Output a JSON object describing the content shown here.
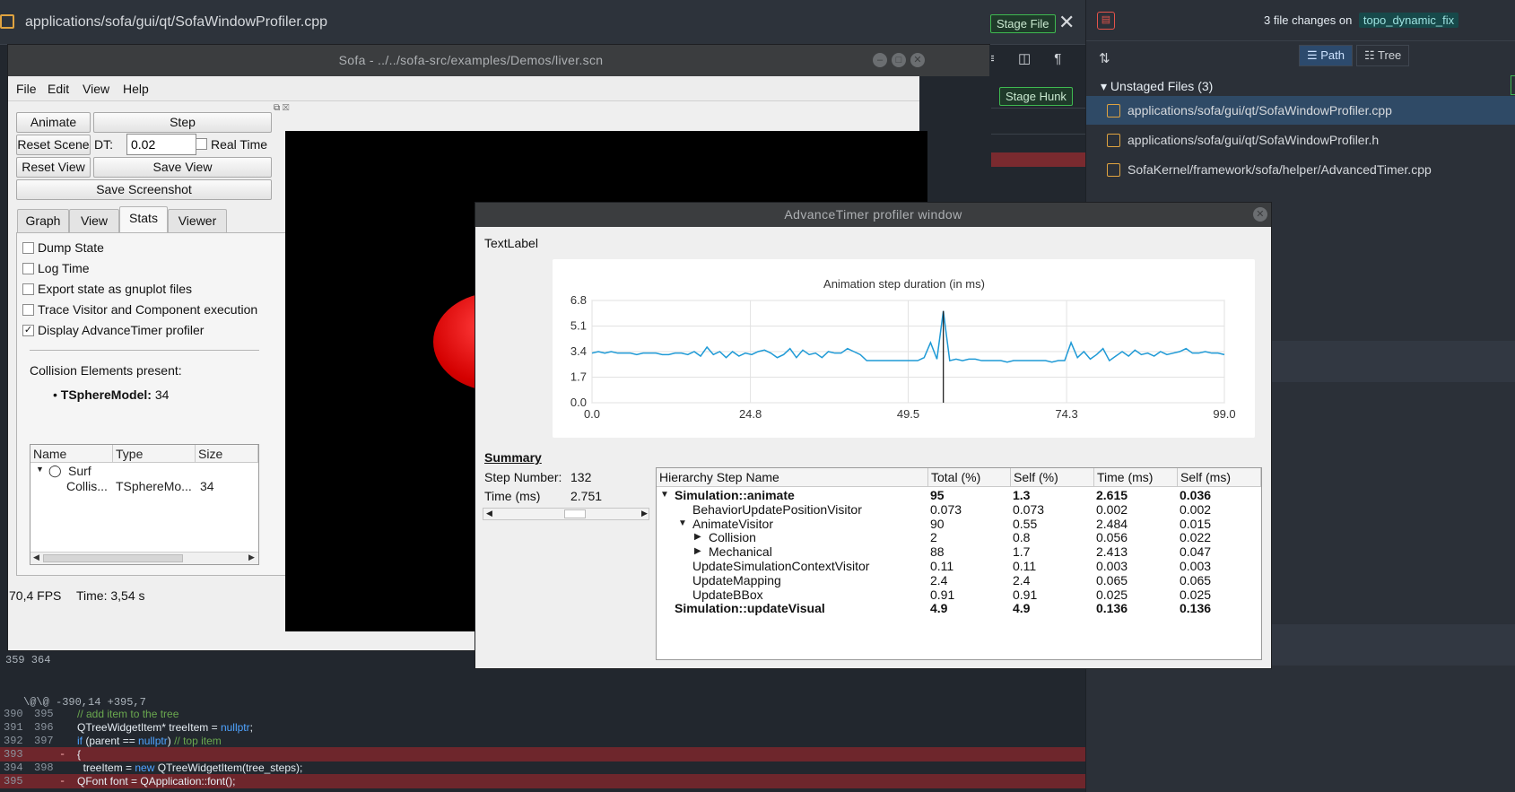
{
  "editor": {
    "file_path": "applications/sofa/gui/qt/SofaWindowProfiler.cpp",
    "stage_file": "Stage File",
    "stage_hunk": "Stage Hunk",
    "close_glyph": "✕",
    "toolbar_icons": [
      "≡",
      "◫",
      "¶"
    ],
    "hunk_line_nums": "359  364",
    "hunk_header": "\\@\\@ -390,14 +395,7",
    "lines": [
      {
        "old": "390",
        "new": "395",
        "code_parts": [
          {
            "t": "// add item to the tree",
            "c": "cm"
          }
        ],
        "removed": false
      },
      {
        "old": "391",
        "new": "396",
        "code_parts": [
          {
            "t": "QTreeWidgetItem* treeItem = ",
            "c": ""
          },
          {
            "t": "nullptr",
            "c": "kw"
          },
          {
            "t": ";",
            "c": ""
          }
        ],
        "removed": false
      },
      {
        "old": "392",
        "new": "397",
        "code_parts": [
          {
            "t": "if",
            "c": "kw"
          },
          {
            "t": " (parent == ",
            "c": ""
          },
          {
            "t": "nullptr",
            "c": "kw"
          },
          {
            "t": ") ",
            "c": ""
          },
          {
            "t": "// top item",
            "c": "cm"
          }
        ],
        "removed": false
      },
      {
        "old": "393",
        "new": "",
        "code_parts": [
          {
            "t": "{",
            "c": ""
          }
        ],
        "removed": true
      },
      {
        "old": "394",
        "new": "398",
        "code_parts": [
          {
            "t": "  treeItem = ",
            "c": ""
          },
          {
            "t": "new",
            "c": "kw"
          },
          {
            "t": " QTreeWidgetItem(tree_steps);",
            "c": ""
          }
        ],
        "removed": false
      },
      {
        "old": "395",
        "new": "",
        "code_parts": [
          {
            "t": "QFont font = QApplication::font();",
            "c": ""
          }
        ],
        "removed": true
      }
    ]
  },
  "git": {
    "trash_icon": "🗑",
    "changes_prefix": "3 file changes on",
    "branch": "topo_dynamic_fix",
    "sort_glyph": "⇅",
    "path_label": "☰ Path",
    "tree_label": "☷ Tree",
    "unstaged_header": "Unstaged Files (3)",
    "files": [
      "applications/sofa/gui/qt/SofaWindowProfiler.cpp",
      "applications/sofa/gui/qt/SofaWindowProfiler.h",
      "SofaKernel/framework/sofa/helper/AdvancedTimer.cpp"
    ]
  },
  "sofa": {
    "title": "Sofa - ../../sofa-src/examples/Demos/liver.scn",
    "menu": [
      "File",
      "Edit",
      "View",
      "Help"
    ],
    "animate": "Animate",
    "step": "Step",
    "reset_scene": "Reset Scene",
    "dt_label": "DT:",
    "dt_value": "0.02",
    "real_time": "Real Time",
    "reset_view": "Reset View",
    "save_view": "Save View",
    "save_screenshot": "Save Screenshot",
    "tabs": [
      "Graph",
      "View",
      "Stats",
      "Viewer"
    ],
    "options": [
      {
        "label": "Dump State",
        "checked": false
      },
      {
        "label": "Log Time",
        "checked": false
      },
      {
        "label": "Export state as gnuplot files",
        "checked": false
      },
      {
        "label": "Trace Visitor and Component execution",
        "checked": false
      },
      {
        "label": "Display AdvanceTimer profiler",
        "checked": true
      }
    ],
    "collision_title": "Collision Elements present:",
    "collision_model": "TSphereModel:",
    "collision_count": "34",
    "table_headers": [
      "Name",
      "Type",
      "Size"
    ],
    "table_node": "Surf",
    "table_row": {
      "name": "Collis...",
      "type": "TSphereMo...",
      "size": "34"
    },
    "fps": "70,4 FPS",
    "time": "Time: 3,54 s"
  },
  "profiler": {
    "title": "AdvanceTimer profiler window",
    "text_label": "TextLabel",
    "summary_title": "Summary",
    "step_label": "Step Number:",
    "step_value": "132",
    "time_label": "Time (ms)",
    "time_value": "2.751",
    "headers": [
      "Hierarchy Step Name",
      "Total (%)",
      "Self (%)",
      "Time (ms)",
      "Self (ms)"
    ],
    "rows": [
      {
        "name": "Simulation::animate",
        "total": "95",
        "self": "1.3",
        "time": "2.615",
        "self_ms": "0.036",
        "level": 0,
        "caret": "down",
        "bold": true
      },
      {
        "name": "BehaviorUpdatePositionVisitor",
        "total": "0.073",
        "self": "0.073",
        "time": "0.002",
        "self_ms": "0.002",
        "level": 1,
        "caret": "",
        "bold": false
      },
      {
        "name": "AnimateVisitor",
        "total": "90",
        "self": "0.55",
        "time": "2.484",
        "self_ms": "0.015",
        "level": 1,
        "caret": "down",
        "bold": false
      },
      {
        "name": "Collision",
        "total": "2",
        "self": "0.8",
        "time": "0.056",
        "self_ms": "0.022",
        "level": 2,
        "caret": "right",
        "bold": false
      },
      {
        "name": "Mechanical",
        "total": "88",
        "self": "1.7",
        "time": "2.413",
        "self_ms": "0.047",
        "level": 2,
        "caret": "right",
        "bold": false
      },
      {
        "name": "UpdateSimulationContextVisitor",
        "total": "0.11",
        "self": "0.11",
        "time": "0.003",
        "self_ms": "0.003",
        "level": 1,
        "caret": "",
        "bold": false
      },
      {
        "name": "UpdateMapping",
        "total": "2.4",
        "self": "2.4",
        "time": "0.065",
        "self_ms": "0.065",
        "level": 1,
        "caret": "",
        "bold": false
      },
      {
        "name": "UpdateBBox",
        "total": "0.91",
        "self": "0.91",
        "time": "0.025",
        "self_ms": "0.025",
        "level": 1,
        "caret": "",
        "bold": false
      },
      {
        "name": "Simulation::updateVisual",
        "total": "4.9",
        "self": "4.9",
        "time": "0.136",
        "self_ms": "0.136",
        "level": 0,
        "caret": "",
        "bold": true
      }
    ]
  },
  "chart_data": {
    "type": "line",
    "title": "Animation step duration (in ms)",
    "xlabel": "",
    "ylabel": "",
    "xlim": [
      0,
      99
    ],
    "ylim": [
      0,
      6.8
    ],
    "x_ticks": [
      "0.0",
      "24.8",
      "49.5",
      "74.3",
      "99.0"
    ],
    "y_ticks": [
      "6.8",
      "5.1",
      "3.4",
      "1.7",
      "0.0"
    ],
    "grid": true,
    "color": "#1f9ad6",
    "marker_x": 55,
    "series": [
      {
        "values": [
          3.3,
          3.4,
          3.3,
          3.4,
          3.3,
          3.3,
          3.3,
          3.2,
          3.3,
          3.3,
          3.3,
          3.2,
          3.2,
          3.3,
          3.3,
          3.2,
          3.4,
          3.1,
          3.7,
          3.2,
          3.4,
          3.0,
          3.4,
          3.1,
          3.3,
          3.2,
          3.4,
          3.5,
          3.3,
          3.0,
          3.2,
          3.6,
          3.0,
          3.5,
          3.2,
          3.3,
          3.0,
          3.4,
          3.3,
          3.3,
          3.6,
          3.4,
          3.2,
          2.8,
          2.8,
          2.8,
          2.8,
          2.8,
          2.8,
          2.8,
          2.8,
          2.8,
          3.0,
          4.0,
          2.9,
          6.1,
          2.8,
          2.9,
          2.8,
          2.9,
          2.9,
          2.8,
          2.8,
          2.8,
          2.8,
          2.7,
          2.8,
          2.8,
          2.8,
          2.8,
          2.8,
          2.8,
          2.7,
          2.8,
          2.8,
          4.0,
          3.0,
          3.4,
          2.9,
          3.2,
          3.6,
          2.8,
          3.1,
          3.4,
          3.1,
          3.5,
          3.2,
          3.3,
          3.1,
          3.4,
          3.2,
          3.3,
          3.4,
          3.6,
          3.3,
          3.3,
          3.4,
          3.3,
          3.3,
          3.2
        ]
      }
    ]
  }
}
